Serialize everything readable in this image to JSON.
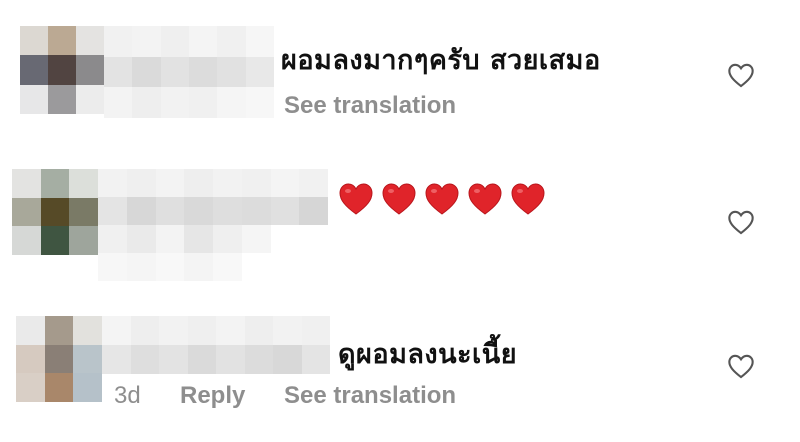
{
  "comments": [
    {
      "text": "ผอมลงมากๆครับ สวยเสมอ",
      "see_translation": "See translation",
      "like_icon": "heart-outline-icon"
    },
    {
      "emoji": [
        "red-heart",
        "red-heart",
        "red-heart",
        "red-heart",
        "red-heart"
      ],
      "like_icon": "heart-outline-icon"
    },
    {
      "text": "ดูผอมลงนะเนี้ย",
      "time": "3d",
      "reply": "Reply",
      "see_translation": "See translation",
      "like_icon": "heart-outline-icon"
    }
  ],
  "colors": {
    "text": "#111111",
    "meta": "#8e8e8e",
    "heart_emoji": "#e0242a",
    "like_icon": "#555555"
  }
}
